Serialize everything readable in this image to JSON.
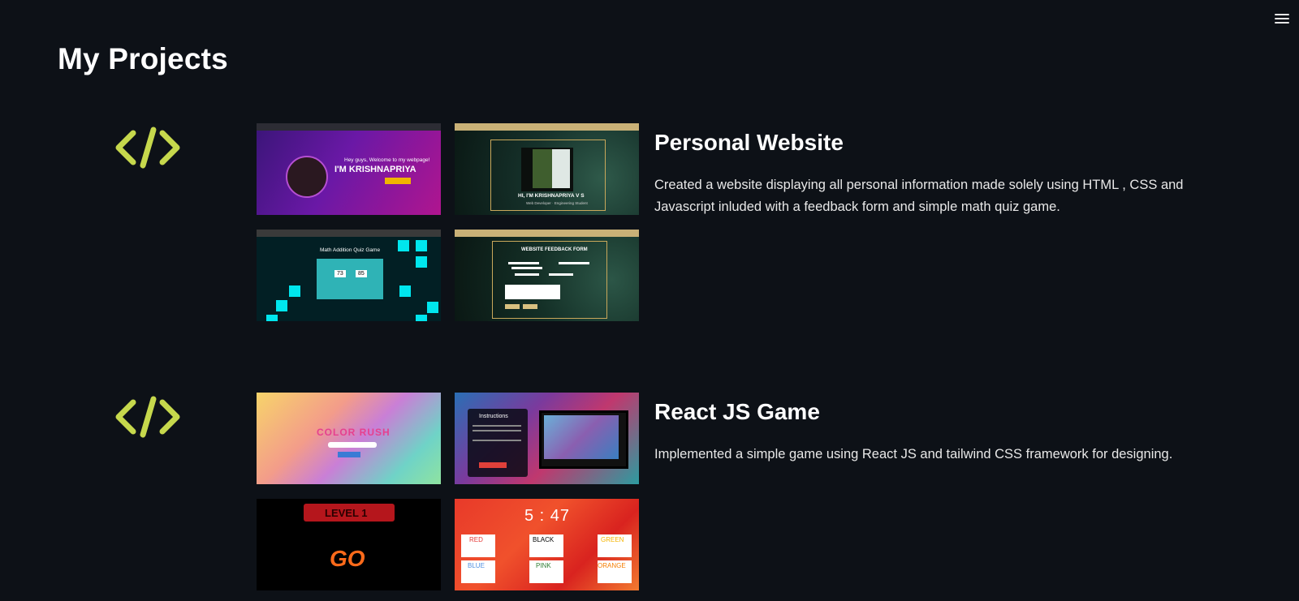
{
  "header": {
    "title": "My Projects",
    "menu_icon": "hamburger-icon"
  },
  "colors": {
    "background": "#0d1117",
    "icon_accent": "#c6d84c"
  },
  "projects": [
    {
      "icon": "code-icon",
      "title": "Personal Website",
      "description": "Created a website displaying all personal information made solely using HTML , CSS and Javascript inluded with a feedback form and simple math quiz game.",
      "screenshots": {
        "s1": {
          "headline": "I'M KRISHNAPRIYA",
          "greeting": "Hey guys, Welcome to my webpage!"
        },
        "s2": {
          "headline": "HI, I'M KRISHNAPRIYA V S",
          "subtitle": "Web Developer · Engineering Student"
        },
        "s3": {
          "headline": "Math Addition Quiz Game",
          "num_a": "73",
          "num_b": "85"
        },
        "s4": {
          "headline": "WEBSITE FEEDBACK FORM"
        }
      }
    },
    {
      "icon": "code-icon",
      "title": "React JS Game",
      "description": "Implemented a simple game using React JS and tailwind CSS framework for designing.",
      "screenshots": {
        "s1": {
          "headline": "COLOR RUSH"
        },
        "s2": {
          "headline": "Instructions"
        },
        "s3": {
          "headline": "LEVEL 1",
          "go": "GO"
        },
        "s4": {
          "timer": "5 : 47",
          "colors": [
            "RED",
            "BLACK",
            "GREEN",
            "BLUE",
            "PINK",
            "ORANGE"
          ]
        }
      }
    }
  ]
}
